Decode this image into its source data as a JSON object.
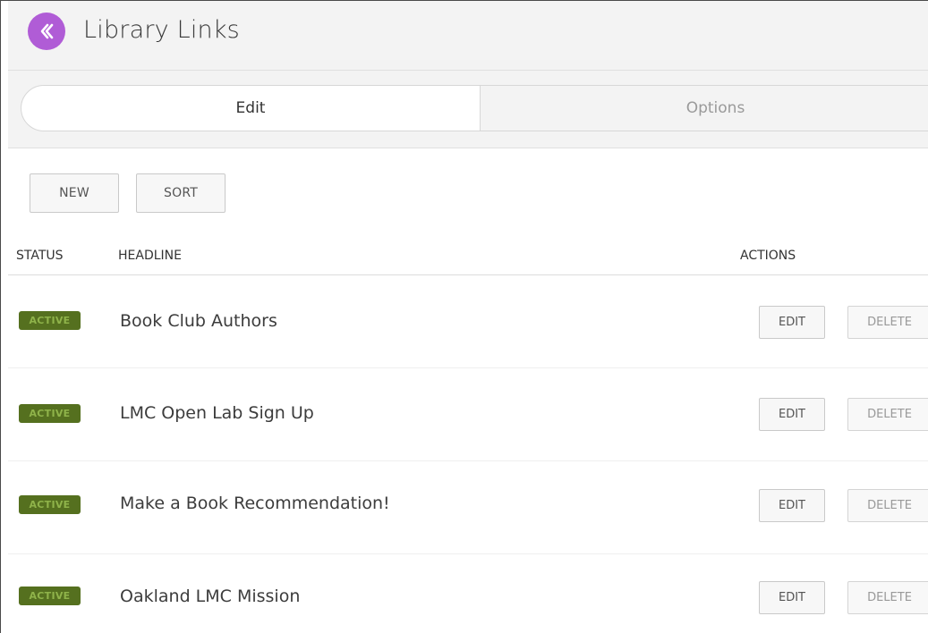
{
  "header": {
    "title": "Library Links",
    "back_icon": "chevron-double-left-icon",
    "accent_color": "#b05cd6"
  },
  "tabs": [
    {
      "label": "Edit",
      "active": true
    },
    {
      "label": "Options",
      "active": false
    }
  ],
  "toolbar": {
    "new_label": "NEW",
    "sort_label": "SORT"
  },
  "table": {
    "columns": {
      "status": "STATUS",
      "headline": "HEADLINE",
      "actions": "ACTIONS"
    },
    "rows": [
      {
        "status": "ACTIVE",
        "headline": "Book Club Authors",
        "edit_label": "EDIT",
        "delete_label": "DELETE"
      },
      {
        "status": "ACTIVE",
        "headline": "LMC Open Lab Sign Up",
        "edit_label": "EDIT",
        "delete_label": "DELETE"
      },
      {
        "status": "ACTIVE",
        "headline": "Make a Book Recommendation!",
        "edit_label": "EDIT",
        "delete_label": "DELETE"
      },
      {
        "status": "ACTIVE",
        "headline": "Oakland LMC Mission",
        "edit_label": "EDIT",
        "delete_label": "DELETE"
      }
    ],
    "status_color": "#55701f"
  }
}
